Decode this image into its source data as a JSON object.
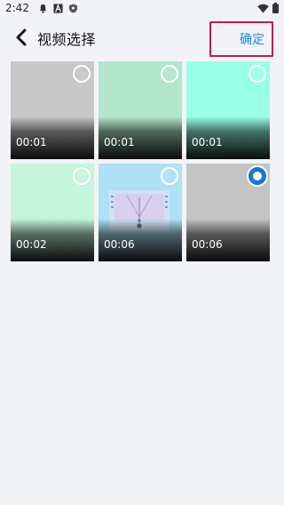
{
  "status_bar": {
    "time": "2:42",
    "icons": [
      "bell-icon",
      "a-icon",
      "shield-icon"
    ],
    "right_icons": [
      "wifi-icon",
      "battery-icon"
    ]
  },
  "nav": {
    "title": "视频选择",
    "confirm_label": "确定",
    "back_icon": "chevron-left-icon"
  },
  "colors": {
    "accent": "#1e88e5",
    "highlight_border": "#c2185b",
    "background": "#f2f3f7"
  },
  "videos": [
    {
      "duration": "00:01",
      "selected": false,
      "color": "#c8c8c8"
    },
    {
      "duration": "00:01",
      "selected": false,
      "color": "#b3e6cc"
    },
    {
      "duration": "00:01",
      "selected": false,
      "color": "#99ffe6"
    },
    {
      "duration": "00:02",
      "selected": false,
      "color": "#c5f5dc"
    },
    {
      "duration": "00:06",
      "selected": false,
      "color": "#aee1f5"
    },
    {
      "duration": "00:06",
      "selected": true,
      "color": "#c4c4c4"
    }
  ]
}
